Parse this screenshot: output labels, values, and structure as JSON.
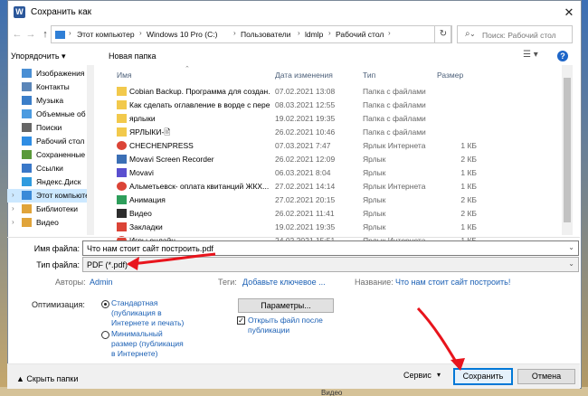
{
  "window": {
    "title": "Сохранить как",
    "close_glyph": "✕",
    "app_icon_letter": "W"
  },
  "nav": {
    "back": "←",
    "forward": "→",
    "up": "↑",
    "breadcrumbs": [
      "Этот компьютер",
      "Windows 10 Pro (C:)",
      "Пользователи",
      "ldmlp",
      "Рабочий стол"
    ],
    "search_placeholder": "Поиск: Рабочий стол"
  },
  "toolbar": {
    "organize": "Упорядочить ▾",
    "new_folder": "Новая папка",
    "view_icon": "☰ ▾",
    "help": "?"
  },
  "sidebar": {
    "items": [
      {
        "label": "Изображения",
        "icon": "images-icon",
        "color": "#4a8fd4"
      },
      {
        "label": "Контакты",
        "icon": "contacts-icon",
        "color": "#5b86b8"
      },
      {
        "label": "Музыка",
        "icon": "music-icon",
        "color": "#3b7ec9"
      },
      {
        "label": "Объемные об",
        "icon": "3d-objects-icon",
        "color": "#4c9be0"
      },
      {
        "label": "Поиски",
        "icon": "searches-icon",
        "color": "#666666"
      },
      {
        "label": "Рабочий стол",
        "icon": "desktop-icon",
        "color": "#2f8de4"
      },
      {
        "label": "Сохраненные",
        "icon": "saved-games-icon",
        "color": "#5a9a3a"
      },
      {
        "label": "Ссылки",
        "icon": "links-icon",
        "color": "#3a78c8"
      },
      {
        "label": "Яндекс.Диск",
        "icon": "yandex-disk-icon",
        "color": "#2f9bdf"
      },
      {
        "label": "Этот компьютер",
        "icon": "computer-icon",
        "color": "#3a8ad8"
      },
      {
        "label": "Библиотеки",
        "icon": "libraries-icon",
        "color": "#e0a43a"
      },
      {
        "label": "Видео",
        "icon": "video-icon",
        "color": "#e0a43a"
      }
    ]
  },
  "columns": {
    "name": "Имя",
    "date": "Дата изменения",
    "type": "Тип",
    "size": "Размер"
  },
  "files": [
    {
      "name": "Cobian Backup. Программа для создан...",
      "date": "07.02.2021 13:08",
      "type": "Папка с файлами",
      "size": "",
      "icon": "folder-icon",
      "color": "#f2c94c"
    },
    {
      "name": "Как сделать оглавление в ворде с пере...",
      "date": "08.03.2021 12:55",
      "type": "Папка с файлами",
      "size": "",
      "icon": "folder-icon",
      "color": "#f2c94c"
    },
    {
      "name": "ярлыки",
      "date": "19.02.2021 19:35",
      "type": "Папка с файлами",
      "size": "",
      "icon": "folder-icon",
      "color": "#f2c94c"
    },
    {
      "name": "ЯРЛЫКИ-🖹",
      "date": "26.02.2021 10:46",
      "type": "Папка с файлами",
      "size": "",
      "icon": "folder-icon",
      "color": "#f2c94c"
    },
    {
      "name": "CHECHENPRESS",
      "date": "07.03.2021 7:47",
      "type": "Ярлык Интернета",
      "size": "1 КБ",
      "icon": "chrome-icon",
      "color": "#db4437"
    },
    {
      "name": "Movavi Screen Recorder",
      "date": "26.02.2021 12:09",
      "type": "Ярлык",
      "size": "2 КБ",
      "icon": "app-shortcut-icon",
      "color": "#3b6fb5"
    },
    {
      "name": "Movavi",
      "date": "06.03.2021 8:04",
      "type": "Ярлык",
      "size": "1 КБ",
      "icon": "app-shortcut-icon",
      "color": "#5a4fcf"
    },
    {
      "name": "Альметьевск- оплата квитанций ЖКХ...",
      "date": "27.02.2021 14:14",
      "type": "Ярлык Интернета",
      "size": "1 КБ",
      "icon": "chrome-icon",
      "color": "#db4437"
    },
    {
      "name": "Анимация",
      "date": "27.02.2021 20:15",
      "type": "Ярлык",
      "size": "2 КБ",
      "icon": "app-shortcut-icon",
      "color": "#2e9e5b"
    },
    {
      "name": "Видео",
      "date": "26.02.2021 11:41",
      "type": "Ярлык",
      "size": "2 КБ",
      "icon": "app-shortcut-icon",
      "color": "#2d2d2d"
    },
    {
      "name": "Закладки",
      "date": "19.02.2021 19:35",
      "type": "Ярлык",
      "size": "1 КБ",
      "icon": "app-shortcut-icon",
      "color": "#db4437"
    },
    {
      "name": "Игры онлайн",
      "date": "24.02.2021 15:51",
      "type": "Ярлык Интернета",
      "size": "1 КБ",
      "icon": "chrome-icon",
      "color": "#db4437"
    }
  ],
  "form": {
    "filename_label": "Имя файла:",
    "filename_value": "Что нам стоит сайт построить.pdf",
    "filetype_label": "Тип файла:",
    "filetype_value": "PDF (*.pdf)",
    "authors_label": "Авторы:",
    "authors_value": "Admin",
    "tags_label": "Теги:",
    "tags_value": "Добавьте ключевое ...",
    "title_label": "Название:",
    "title_value": "Что нам стоит сайт построить!",
    "optimization_label": "Оптимизация:",
    "opt_standard_lines": [
      "Стандартная",
      "(публикация в",
      "Интернете и печать)"
    ],
    "opt_min_lines": [
      "Минимальный",
      "размер (публикация",
      "в Интернете)"
    ],
    "params_button": "Параметры...",
    "open_after_lines": [
      "Открыть файл после",
      "публикации"
    ],
    "checkbox_mark": "✓"
  },
  "footer": {
    "hide_folders": "▲  Скрыть папки",
    "service": "Сервис",
    "save": "Сохранить",
    "cancel": "Отмена"
  },
  "background": {
    "bottom_text": "Видео"
  },
  "colors": {
    "accent": "#0078d7",
    "link": "#1a5fb4",
    "annotation_arrow": "#e8141c"
  }
}
